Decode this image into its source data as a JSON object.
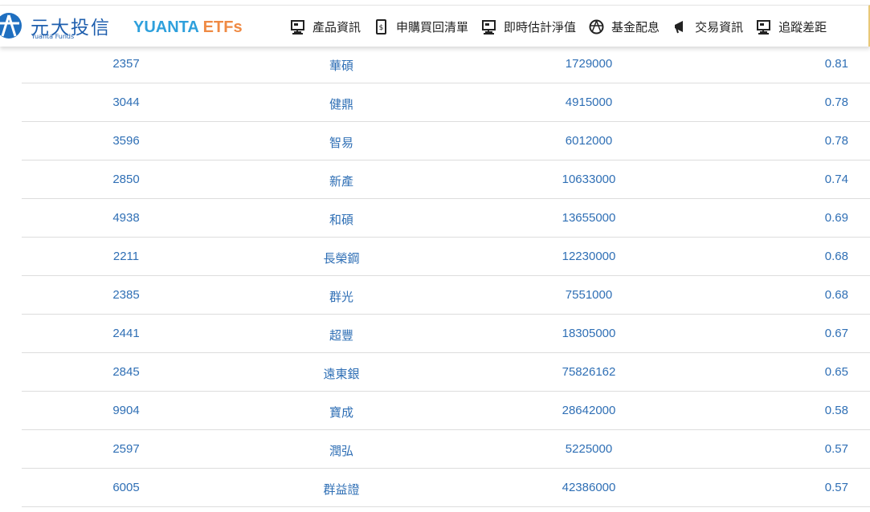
{
  "header": {
    "brand_cn": "元大投信",
    "brand_en": "Yuanta Funds",
    "etf_prefix": "YUANTA",
    "etf_suffix": "ETFs",
    "nav": [
      {
        "label": "產品資訊",
        "icon": "monitor-icon"
      },
      {
        "label": "申購買回清單",
        "icon": "dollar-doc-icon"
      },
      {
        "label": "即時估計淨值",
        "icon": "monitor-icon"
      },
      {
        "label": "基金配息",
        "icon": "globe-icon"
      },
      {
        "label": "交易資訊",
        "icon": "megaphone-icon"
      },
      {
        "label": "追蹤差距",
        "icon": "monitor-icon"
      }
    ]
  },
  "rows": [
    {
      "code": "2357",
      "name": "華碩",
      "shares": "1729000",
      "weight": "0.81"
    },
    {
      "code": "3044",
      "name": "健鼎",
      "shares": "4915000",
      "weight": "0.78"
    },
    {
      "code": "3596",
      "name": "智易",
      "shares": "6012000",
      "weight": "0.78"
    },
    {
      "code": "2850",
      "name": "新產",
      "shares": "10633000",
      "weight": "0.74"
    },
    {
      "code": "4938",
      "name": "和碩",
      "shares": "13655000",
      "weight": "0.69"
    },
    {
      "code": "2211",
      "name": "長榮鋼",
      "shares": "12230000",
      "weight": "0.68"
    },
    {
      "code": "2385",
      "name": "群光",
      "shares": "7551000",
      "weight": "0.68"
    },
    {
      "code": "2441",
      "name": "超豐",
      "shares": "18305000",
      "weight": "0.67"
    },
    {
      "code": "2845",
      "name": "遠東銀",
      "shares": "75826162",
      "weight": "0.65"
    },
    {
      "code": "9904",
      "name": "寶成",
      "shares": "28642000",
      "weight": "0.58"
    },
    {
      "code": "2597",
      "name": "潤弘",
      "shares": "5225000",
      "weight": "0.57"
    },
    {
      "code": "6005",
      "name": "群益證",
      "shares": "42386000",
      "weight": "0.57"
    }
  ]
}
